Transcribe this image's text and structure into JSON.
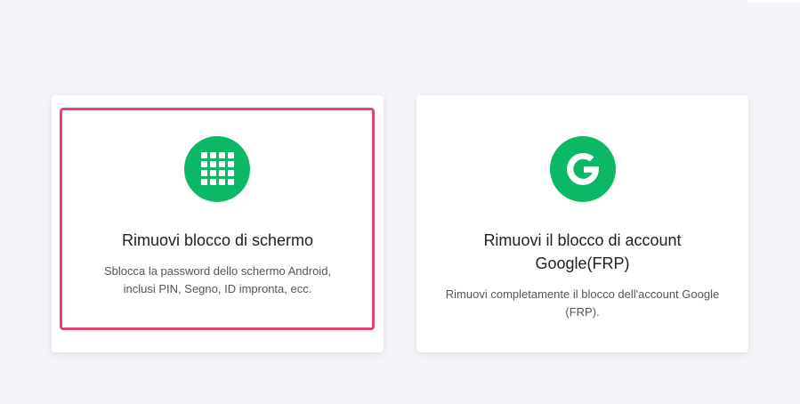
{
  "cards": [
    {
      "title": "Rimuovi blocco di schermo",
      "description": "Sblocca la password dello schermo Android, inclusi PIN, Segno, ID impronta, ecc.",
      "icon": "keypad-grid-icon",
      "selected": true
    },
    {
      "title": "Rimuovi il blocco di account Google(FRP)",
      "description": "Rimuovi completamente il blocco dell'account Google (FRP).",
      "icon": "google-g-icon",
      "selected": false
    }
  ],
  "colors": {
    "accent_green": "#0ab865",
    "selection_border": "#e2456f",
    "background": "#f4f5f9"
  }
}
